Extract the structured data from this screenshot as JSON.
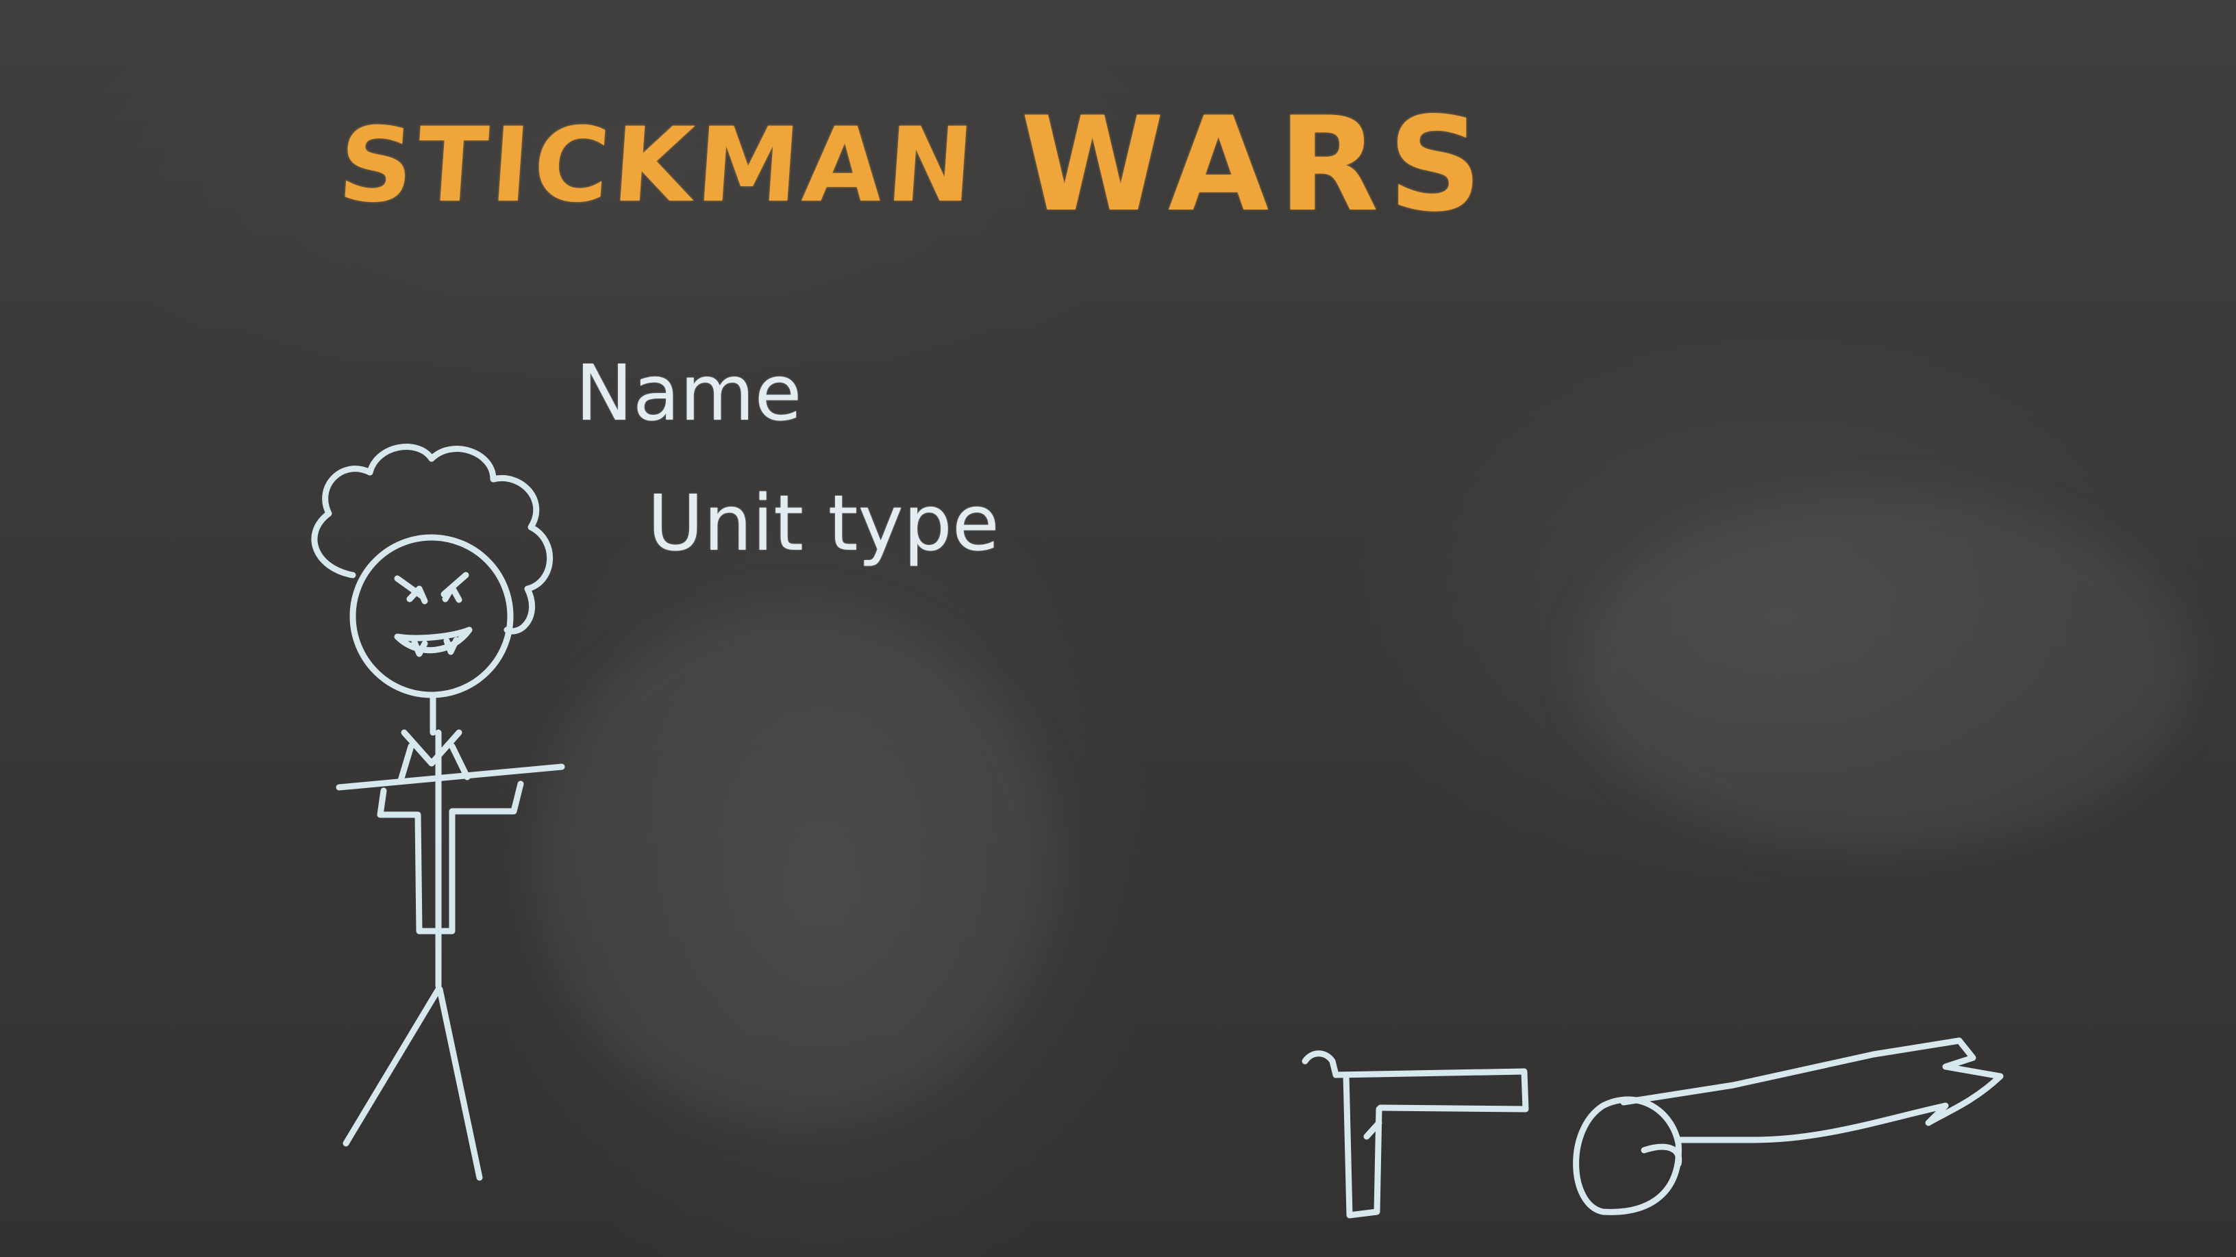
{
  "title": {
    "part1": "STICKMAN",
    "part2": "WARS"
  },
  "unit_info": {
    "name_label": "Name",
    "unit_type_label": "Unit type"
  },
  "colors": {
    "board": "#3b3a39",
    "title_chalk": "#f0a53a",
    "white_chalk": "#e3ecf1",
    "sketch_chalk": "#d6e8ee"
  },
  "icons": [
    "stickman-character-icon",
    "pistol-icon",
    "sword-arm-icon"
  ]
}
